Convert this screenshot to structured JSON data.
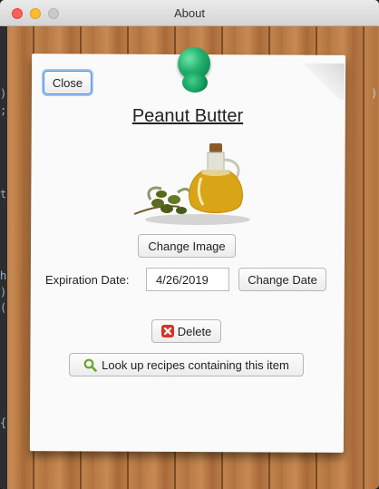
{
  "window": {
    "title": "About"
  },
  "item": {
    "name": "Peanut Butter",
    "image": "olive-oil-bottle-with-olives"
  },
  "buttons": {
    "close": "Close",
    "change_image": "Change Image",
    "change_date": "Change Date",
    "delete": "Delete",
    "lookup": "Look up recipes containing this item"
  },
  "expiration": {
    "label": "Expiration Date:",
    "value": "4/26/2019"
  },
  "background_code": {
    "left": [
      ")",
      ";",
      "t",
      "h",
      ")",
      "(",
      "{"
    ],
    "right": [
      ")"
    ]
  },
  "colors": {
    "pin": "#1fae6b",
    "focus": "#4b8fd9",
    "paper": "#fafafa"
  }
}
